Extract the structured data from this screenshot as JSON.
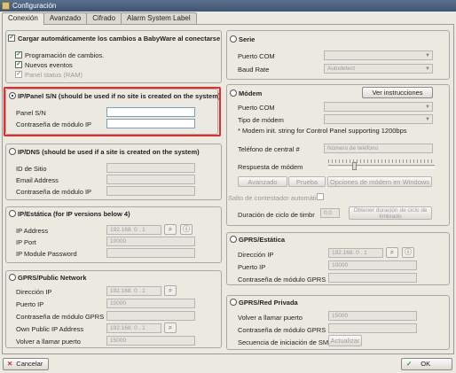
{
  "window": {
    "title": "Configuración"
  },
  "tabs": [
    "Conexión",
    "Avanzado",
    "Cifrado",
    "Alarm System Label"
  ],
  "auto_load": {
    "label": "Cargar automáticamente los cambios a BabyWare al conectarse",
    "options": [
      "Programación de cambios.",
      "Nuevos eventos",
      "Panel status (RAM)"
    ]
  },
  "ip_panel": {
    "title": "IP/Panel S/N (should be used if no site is created on the system)",
    "panel_sn": "Panel S/N",
    "module_pw": "Contraseña de módulo IP"
  },
  "ip_dns": {
    "title": "IP/DNS (should be used if a site is created on the system)",
    "site_id": "ID de Sitio",
    "email": "Email Address",
    "module_pw": "Contraseña de módulo IP"
  },
  "ip_static": {
    "title": "IP/Estática (for IP versions below 4)",
    "ip_address": "IP Address",
    "ip_value": "192.168. 0 . 1",
    "ip_port": "IP Port",
    "port_value": "10000",
    "module_password": "IP Module Password"
  },
  "gprs_public": {
    "title": "GPRS/Public Network",
    "ip_dir": "Dirección IP",
    "ip_value": "192.168. 0 . 1",
    "port": "Puerto IP",
    "port_value": "10000",
    "gprs_pw": "Contraseña de módulo GPRS",
    "own_ip": "Own Public IP Address",
    "own_ip_value": "192.168. 0 . 1",
    "callback": "Volver a llamar puerto",
    "callback_value": "15000"
  },
  "serial": {
    "title": "Serie",
    "com": "Puerto COM",
    "baud": "Baud Rate",
    "baud_value": "Autodetect"
  },
  "modem": {
    "title": "Módem",
    "instructions_btn": "Ver instrucciones",
    "com": "Puerto COM",
    "type": "Tipo de módem",
    "note": "* Modem init. string for Control Panel supporting 1200bps",
    "central_phone": "Teléfono de central #",
    "phone_placeholder": "Número de teléfono",
    "response": "Respuesta de módem",
    "advanced_btn": "Avanzado",
    "test_btn": "Prueba",
    "options_btn": "Opciones de módem en Windows",
    "skip_answering": "Salto de contestador automático",
    "ring_duration": "Duración de ciclo de timbr",
    "ring_value": "0,0",
    "get_ring_btn": "Obtener duración de ciclo de timbrado"
  },
  "gprs_static": {
    "title": "GPRS/Estática",
    "ip_dir": "Dirección IP",
    "ip_value": "192.168. 0 . 1",
    "port": "Puerto IP",
    "port_value": "10000",
    "gprs_pw": "Contraseña de módulo GPRS"
  },
  "gprs_private": {
    "title": "GPRS/Red Privada",
    "callback": "Volver a llamar puerto",
    "callback_value": "15000",
    "gprs_pw": "Contraseña de módulo GPRS",
    "sms_seq": "Secuencia de iniciación de SMS",
    "update_btn": "Actualizar"
  },
  "footer": {
    "cancel": "Cancelar",
    "ok": "OK"
  }
}
